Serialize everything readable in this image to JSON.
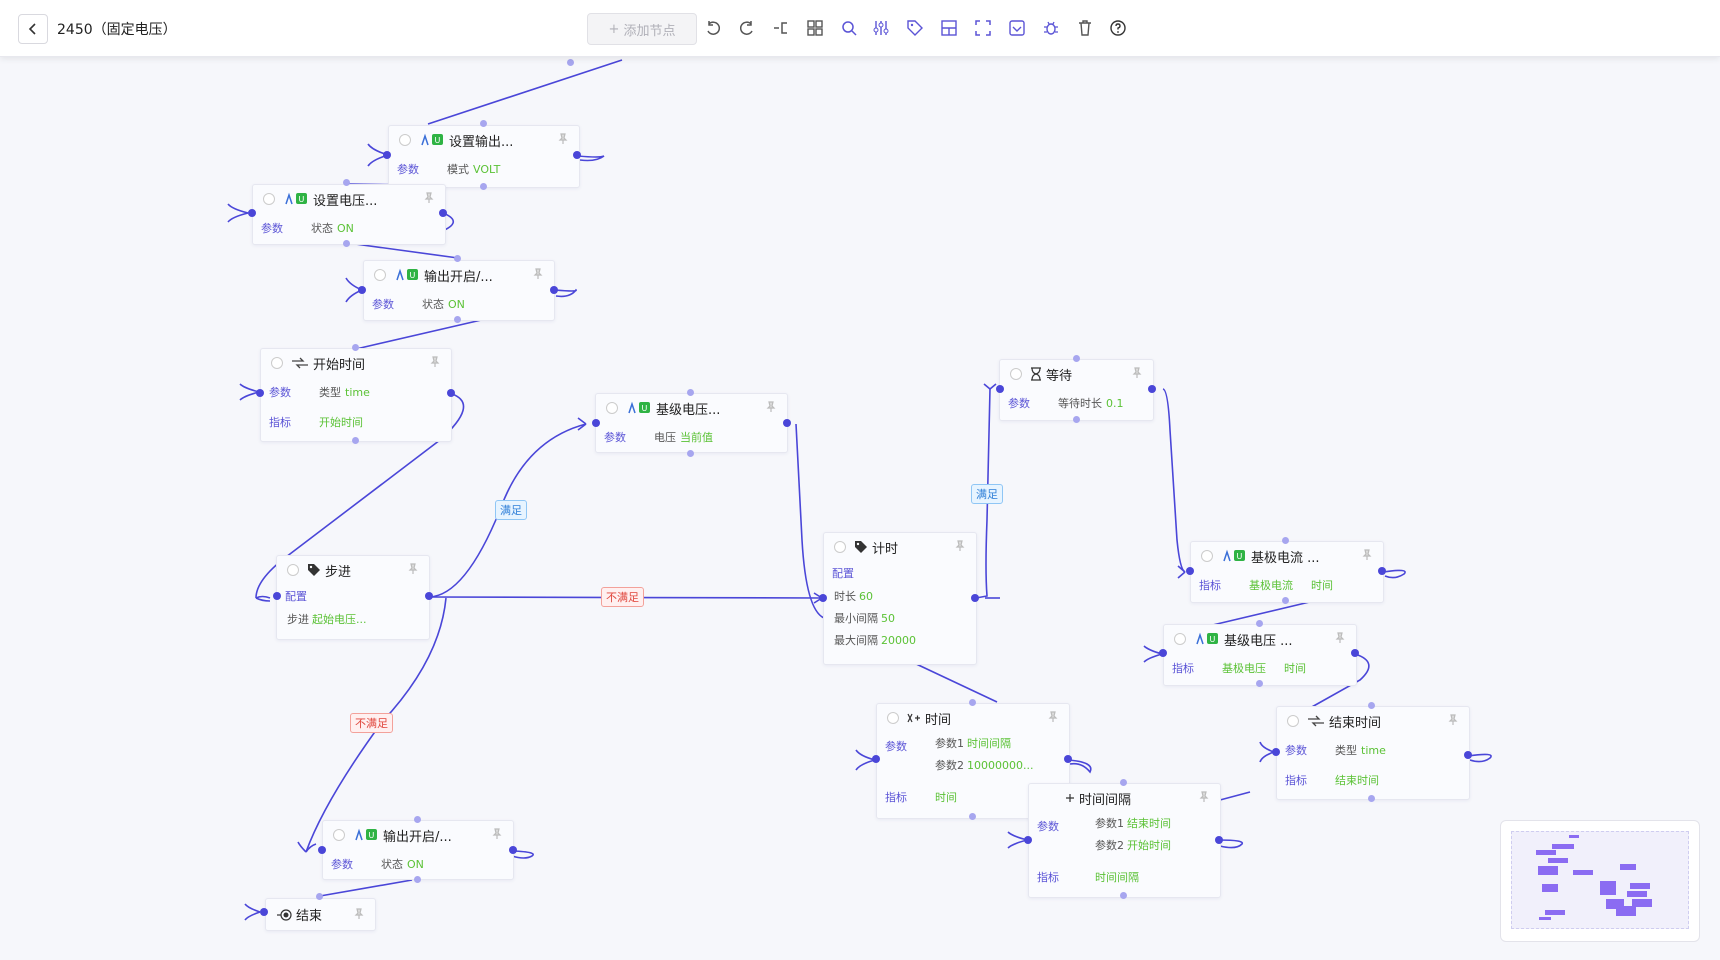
{
  "header": {
    "title": "2450（固定电压）",
    "add_node_label": "添加节点",
    "tools": [
      "undo-icon",
      "redo-icon",
      "branch-icon",
      "layout-icon",
      "search-icon",
      "sliders-icon",
      "tag-icon",
      "panel-icon",
      "fullscreen-icon",
      "save-icon",
      "debug-icon",
      "delete-icon",
      "help-icon"
    ]
  },
  "labels": {
    "param": "参数",
    "metric": "指标",
    "config": "配置"
  },
  "edge_labels": {
    "ok1": "满足",
    "no1": "不满足",
    "no2": "不满足",
    "ok2": "满足"
  },
  "nodes": {
    "set_output": {
      "title": "设置输出...",
      "row_key": "参数",
      "row_name": "模式",
      "row_val": "VOLT"
    },
    "set_voltage": {
      "title": "设置电压...",
      "row_key": "参数",
      "row_name": "状态",
      "row_val": "ON"
    },
    "output_on1": {
      "title": "输出开启/...",
      "row_key": "参数",
      "row_name": "状态",
      "row_val": "ON"
    },
    "start_time": {
      "title": "开始时间",
      "r1_key": "参数",
      "r1_name": "类型",
      "r1_val": "time",
      "r2_key": "指标",
      "r2_val": "开始时间"
    },
    "base_voltage": {
      "title": "基级电压...",
      "row_key": "参数",
      "row_name": "电压",
      "row_val": "当前值"
    },
    "step": {
      "title": "步进",
      "cfg": "配置",
      "sub_name": "步进",
      "sub_val": "起始电压..."
    },
    "timer": {
      "title": "计时",
      "cfg": "配置",
      "s1n": "时长",
      "s1v": "60",
      "s2n": "最小间隔",
      "s2v": "50",
      "s3n": "最大间隔",
      "s3v": "20000"
    },
    "wait": {
      "title": "等待",
      "row_key": "参数",
      "row_name": "等待时长",
      "row_val": "0.1"
    },
    "base_current": {
      "title": "基极电流 ...",
      "row_key": "指标",
      "v1": "基极电流",
      "v2": "时间"
    },
    "base_voltage2": {
      "title": "基级电压 ...",
      "row_key": "指标",
      "v1": "基极电压",
      "v2": "时间"
    },
    "time": {
      "title": "时间",
      "r1_key": "参数",
      "p1n": "参数1",
      "p1v": "时间间隔",
      "p2n": "参数2",
      "p2v": "10000000...",
      "r2_key": "指标",
      "r2_val": "时间"
    },
    "end_time": {
      "title": "结束时间",
      "r1_key": "参数",
      "r1_name": "类型",
      "r1_val": "time",
      "r2_key": "指标",
      "r2_val": "结束时间"
    },
    "time_interval": {
      "title": "时间间隔",
      "r1_key": "参数",
      "p1n": "参数1",
      "p1v": "结束时间",
      "p2n": "参数2",
      "p2v": "开始时间",
      "r2_key": "指标",
      "r2_val": "时间间隔"
    },
    "output_on2": {
      "title": "输出开启/...",
      "row_key": "参数",
      "row_name": "状态",
      "row_val": "ON"
    },
    "end": {
      "title": "结束"
    }
  },
  "colors": {
    "edge": "#4a46d8",
    "accent": "#5b54d6",
    "value_green": "#5bc236",
    "minimap": "#8b6cf2"
  }
}
